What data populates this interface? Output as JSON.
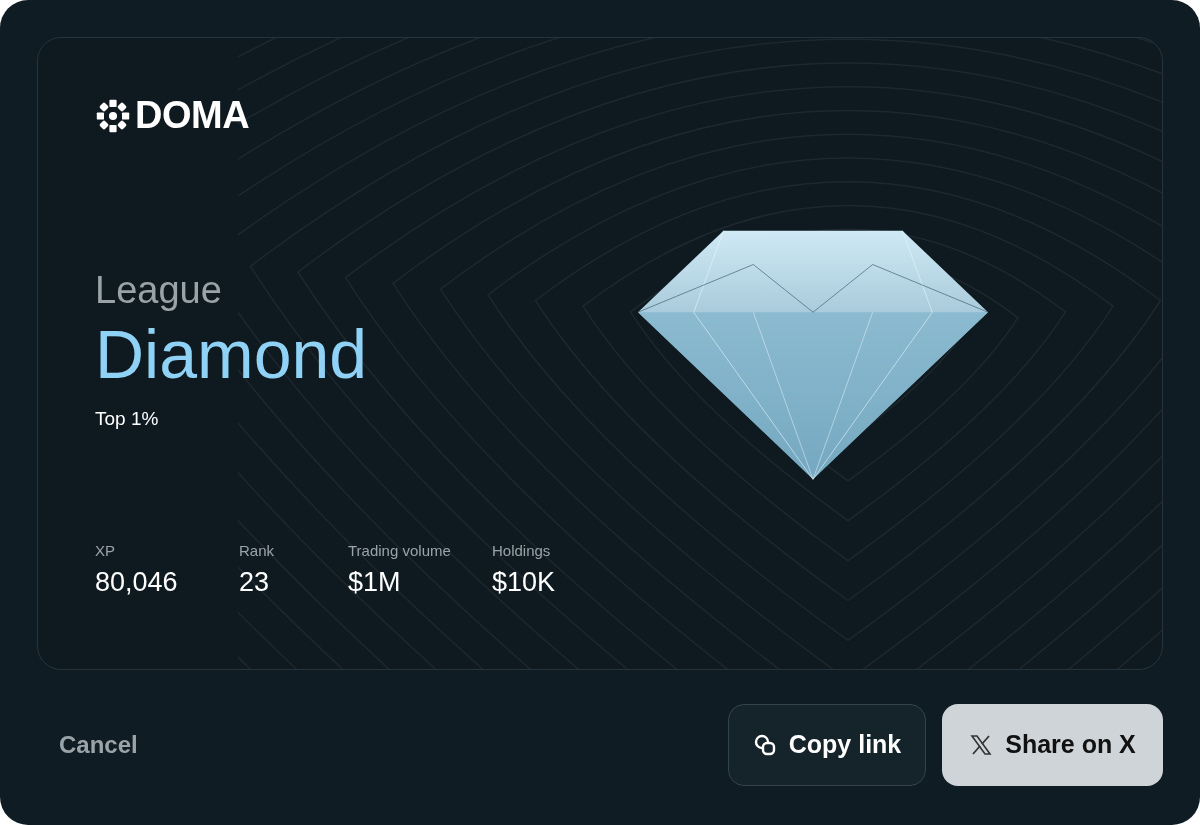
{
  "brand": {
    "name": "DOMA"
  },
  "league": {
    "label": "League",
    "tier": "Diamond",
    "percentile": "Top 1%"
  },
  "stats": [
    {
      "label": "XP",
      "value": "80,046"
    },
    {
      "label": "Rank",
      "value": "23"
    },
    {
      "label": "Trading volume",
      "value": "$1M"
    },
    {
      "label": "Holdings",
      "value": "$10K"
    }
  ],
  "actions": {
    "cancel": "Cancel",
    "copy": "Copy link",
    "share": "Share on X"
  }
}
